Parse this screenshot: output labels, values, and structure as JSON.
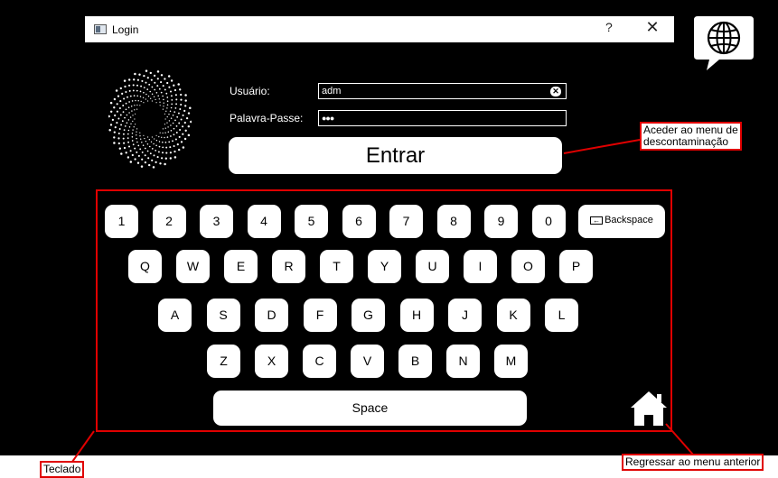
{
  "window": {
    "title": "Login",
    "help_label": "?",
    "close_label": "✕"
  },
  "form": {
    "user_label": "Usuário:",
    "user_value": "adm",
    "clear_label": "✕",
    "password_label": "Palavra-Passe:",
    "password_value": "●●●",
    "submit_label": "Entrar"
  },
  "keyboard": {
    "row_numbers": [
      "1",
      "2",
      "3",
      "4",
      "5",
      "6",
      "7",
      "8",
      "9",
      "0"
    ],
    "backspace_label": "Backspace",
    "row_qwerty": [
      "Q",
      "W",
      "E",
      "R",
      "T",
      "Y",
      "U",
      "I",
      "O",
      "P"
    ],
    "row_asdf": [
      "A",
      "S",
      "D",
      "F",
      "G",
      "H",
      "J",
      "K",
      "L"
    ],
    "row_zxcv": [
      "Z",
      "X",
      "C",
      "V",
      "B",
      "N",
      "M"
    ],
    "space_label": "Space"
  },
  "annotations": {
    "entrar_note": [
      "Aceder ao menu de",
      "descontaminação"
    ],
    "keyboard_note": "Teclado",
    "home_note": "Regressar ao menu anterior"
  },
  "colors": {
    "background": "#000000",
    "key": "#ffffff",
    "annotation": "#e00000"
  },
  "icons": {
    "language": "globe-speech-bubble-icon",
    "home": "home-icon",
    "logo": "spiral-dots-logo"
  }
}
